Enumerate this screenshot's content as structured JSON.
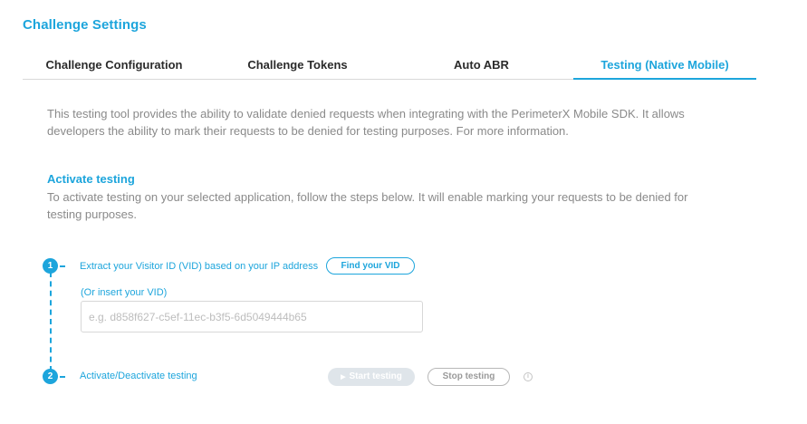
{
  "page": {
    "title": "Challenge Settings"
  },
  "tabs": [
    {
      "label": "Challenge Configuration",
      "active": false
    },
    {
      "label": "Challenge Tokens",
      "active": false
    },
    {
      "label": "Auto ABR",
      "active": false
    },
    {
      "label": "Testing (Native Mobile)",
      "active": true
    }
  ],
  "intro": "This testing tool provides the ability to validate denied requests when integrating with the PerimeterX Mobile SDK. It allows developers the ability to mark their requests to be denied for testing purposes. For more information.",
  "activate": {
    "title": "Activate testing",
    "description": "To activate testing on your selected application, follow the steps below. It will enable marking your requests to be denied for testing purposes."
  },
  "steps": [
    {
      "number": "1",
      "label": "Extract your Visitor ID (VID) based on your IP address",
      "button": "Find your VID",
      "sublabel": "(Or insert your VID)",
      "input_placeholder": "e.g. d858f627-c5ef-11ec-b3f5-6d5049444b65",
      "input_value": ""
    },
    {
      "number": "2",
      "label": "Activate/Deactivate testing",
      "start_button": "Start testing",
      "stop_button": "Stop testing"
    }
  ],
  "colors": {
    "accent": "#1da5dc",
    "muted_text": "#8a8a8a",
    "disabled": "#dfe5ea"
  },
  "icons": {
    "play": "play-icon",
    "info": "info-icon"
  }
}
